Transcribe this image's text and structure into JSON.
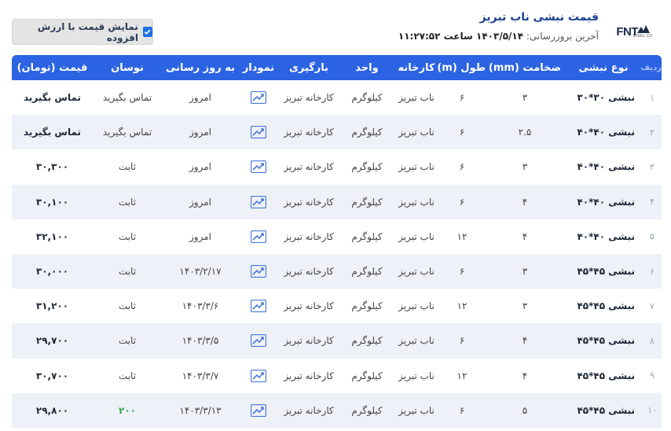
{
  "header": {
    "title": "قیمت نبشی ناب تبریز",
    "update_label": "آخرین بروزرسانی:",
    "update_value": "۱۴۰۳/۵/۱۴ ساعت ۱۱:۲۷:۵۲",
    "logo_text": "FNT",
    "logo_sub": "STEEL CO"
  },
  "vat_toggle": {
    "label": "نمایش قیمت با ارزش افزوده",
    "checked": true
  },
  "columns": [
    "ردیف",
    "نوع نبشی",
    "ضخامت (mm)",
    "طول (m)",
    "کارخانه",
    "واحد",
    "بارگیری",
    "نمودار",
    "به روز رسانی",
    "نوسان",
    "قیمت (تومان)"
  ],
  "rows": [
    {
      "rn": "۱",
      "name": "نبشی ۳۰*۳۰",
      "thick": "۳",
      "len": "۶",
      "factory": "ناب تبریز",
      "unit": "کیلوگرم",
      "load": "کارخانه تبریز",
      "update": "امروز",
      "change": "تماس بگیرید",
      "price": "تماس بگیرید"
    },
    {
      "rn": "۲",
      "name": "نبشی ۴۰*۴۰",
      "thick": "۲.۵",
      "len": "۶",
      "factory": "ناب تبریز",
      "unit": "کیلوگرم",
      "load": "کارخانه تبریز",
      "update": "امروز",
      "change": "تماس بگیرید",
      "price": "تماس بگیرید"
    },
    {
      "rn": "۳",
      "name": "نبشی ۴۰*۴۰",
      "thick": "۳",
      "len": "۶",
      "factory": "ناب تبریز",
      "unit": "کیلوگرم",
      "load": "کارخانه تبریز",
      "update": "امروز",
      "change": "ثابت",
      "price": "۳۰,۳۰۰"
    },
    {
      "rn": "۴",
      "name": "نبشی ۴۰*۴۰",
      "thick": "۴",
      "len": "۶",
      "factory": "ناب تبریز",
      "unit": "کیلوگرم",
      "load": "کارخانه تبریز",
      "update": "امروز",
      "change": "ثابت",
      "price": "۳۰,۱۰۰"
    },
    {
      "rn": "۵",
      "name": "نبشی ۴۰*۴۰",
      "thick": "۴",
      "len": "۱۲",
      "factory": "ناب تبریز",
      "unit": "کیلوگرم",
      "load": "کارخانه تبریز",
      "update": "امروز",
      "change": "ثابت",
      "price": "۳۲,۱۰۰"
    },
    {
      "rn": "۶",
      "name": "نبشی ۴۵*۴۵",
      "thick": "۳",
      "len": "۶",
      "factory": "ناب تبریز",
      "unit": "کیلوگرم",
      "load": "کارخانه تبریز",
      "update": "۱۴۰۳/۲/۱۷",
      "change": "ثابت",
      "price": "۳۰,۰۰۰"
    },
    {
      "rn": "۷",
      "name": "نبشی ۴۵*۴۵",
      "thick": "۳",
      "len": "۱۲",
      "factory": "ناب تبریز",
      "unit": "کیلوگرم",
      "load": "کارخانه تبریز",
      "update": "۱۴۰۳/۳/۶",
      "change": "ثابت",
      "price": "۳۱,۲۰۰"
    },
    {
      "rn": "۸",
      "name": "نبشی ۴۵*۴۵",
      "thick": "۴",
      "len": "۶",
      "factory": "ناب تبریز",
      "unit": "کیلوگرم",
      "load": "کارخانه تبریز",
      "update": "۱۴۰۳/۳/۵",
      "change": "ثابت",
      "price": "۲۹,۷۰۰"
    },
    {
      "rn": "۹",
      "name": "نبشی ۴۵*۴۵",
      "thick": "۴",
      "len": "۱۲",
      "factory": "ناب تبریز",
      "unit": "کیلوگرم",
      "load": "کارخانه تبریز",
      "update": "۱۴۰۳/۳/۷",
      "change": "ثابت",
      "price": "۳۰,۷۰۰"
    },
    {
      "rn": "۱۰",
      "name": "نبشی ۴۵*۴۵",
      "thick": "۵",
      "len": "۶",
      "factory": "ناب تبریز",
      "unit": "کیلوگرم",
      "load": "کارخانه تبریز",
      "update": "۱۴۰۳/۳/۱۳",
      "change": "۲۰۰",
      "change_positive": true,
      "price": "۲۹,۸۰۰"
    }
  ],
  "colors": {
    "header_bg": "#2b63e2",
    "accent": "#1f6fe5",
    "positive": "#2fa84a"
  },
  "icons": {
    "chart": "trend-chart-icon",
    "check": "checkbox-checked-icon"
  }
}
